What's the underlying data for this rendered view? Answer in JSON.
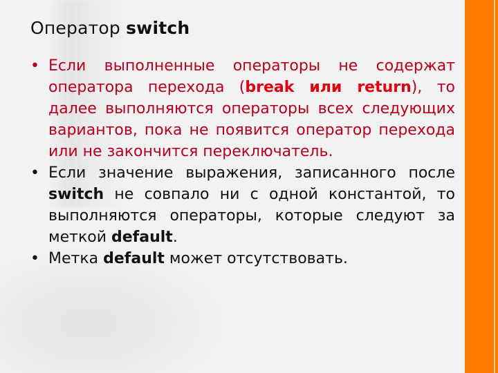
{
  "slide": {
    "title_plain": "Оператор ",
    "title_bold": "switch",
    "colors": {
      "background": "#f2f2f2",
      "accent_bar": "#ff7a00",
      "accent_stripe": "#f7c98a",
      "emphasis_text": "#b8001f",
      "highlight_text": "#e00012",
      "body_text": "#111111"
    },
    "bullets": [
      {
        "color": "red",
        "parts": {
          "p1": "Если выполненные операторы не содержат оператора перехода (",
          "b1": "break или return",
          "p2": "), то далее выполняются операторы всех следующих вариантов, пока не появится оператор перехода или не закончится переключатель."
        }
      },
      {
        "color": "black",
        "parts": {
          "p1": "Если значение выражения, записанного после ",
          "b1": "switch",
          "p2": " не совпало ни с одной константой, то выполняются операторы, которые следуют за меткой ",
          "b2": "default",
          "p3": "."
        }
      },
      {
        "color": "black",
        "parts": {
          "p1": "Метка ",
          "b1": "default",
          "p2": " может отсутствовать."
        }
      }
    ],
    "bullet_glyph": "•"
  }
}
